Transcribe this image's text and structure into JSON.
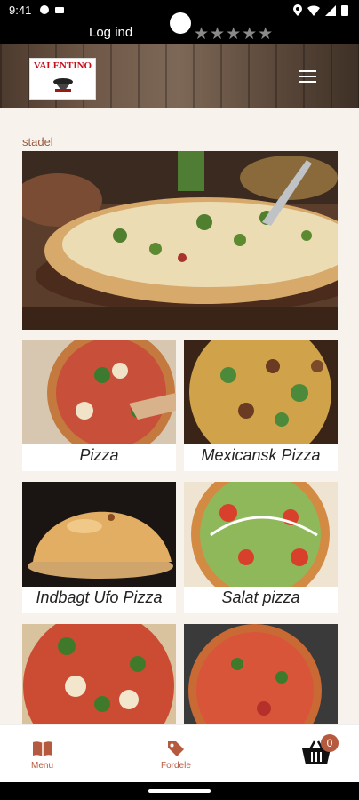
{
  "status_bar": {
    "time": "9:41"
  },
  "topbar": {
    "login_label": "Log ind",
    "rating_stars": "★★★★★"
  },
  "header": {
    "logo_text": "VALENTINO",
    "menu_icon": "hamburger-menu-icon"
  },
  "section": {
    "title": "stadel"
  },
  "categories": [
    {
      "label": "Pizza"
    },
    {
      "label": "Mexicansk Pizza"
    },
    {
      "label": "Indbagt Ufo Pizza"
    },
    {
      "label": "Salat pizza"
    },
    {
      "label": ""
    },
    {
      "label": ""
    }
  ],
  "bottom_nav": {
    "menu_label": "Menu",
    "deals_label": "Fordele",
    "cart_count": "0"
  },
  "colors": {
    "accent": "#b55a3f",
    "background": "#f7f3ec"
  }
}
